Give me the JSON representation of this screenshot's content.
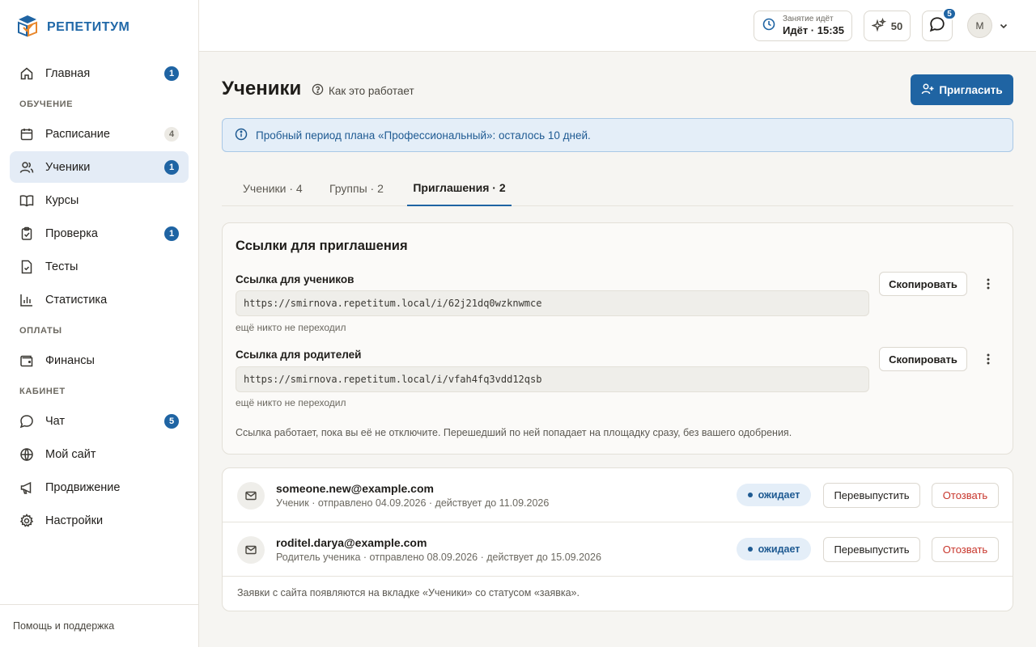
{
  "brand": {
    "name": "РЕПЕТИТУМ"
  },
  "sidebar": {
    "items": [
      {
        "label": "Главная",
        "badge": "1",
        "icon": "home-icon"
      },
      {
        "section": "ОБУЧЕНИЕ"
      },
      {
        "label": "Расписание",
        "badge": "4",
        "icon": "calendar-icon"
      },
      {
        "label": "Ученики",
        "badge": "1",
        "icon": "users-icon",
        "active": true
      },
      {
        "label": "Курсы",
        "icon": "book-icon"
      },
      {
        "label": "Проверка",
        "badge": "1",
        "icon": "clipboard-check-icon"
      },
      {
        "label": "Тесты",
        "icon": "test-file-icon"
      },
      {
        "label": "Статистика",
        "icon": "bar-chart-icon"
      },
      {
        "section": "ОПЛАТЫ"
      },
      {
        "label": "Финансы",
        "icon": "wallet-icon"
      },
      {
        "section": "КАБИНЕТ"
      },
      {
        "label": "Чат",
        "badge": "5",
        "icon": "chat-icon"
      },
      {
        "label": "Мой сайт",
        "icon": "globe-icon"
      },
      {
        "label": "Продвижение",
        "icon": "megaphone-icon"
      },
      {
        "label": "Настройки",
        "icon": "gear-icon"
      }
    ],
    "footer": "Помощь и поддержка"
  },
  "topbar": {
    "lesson_caption": "Занятие идёт",
    "lesson_status": "Идёт · 15:35",
    "points": "50",
    "chat_badge": "5",
    "avatar_initial": "М"
  },
  "page": {
    "title": "Ученики",
    "howto": "Как это работает",
    "invite_button": "Пригласить",
    "trial_notice": "Пробный период плана «Профессиональный»: осталось 10 дней."
  },
  "tabs": [
    {
      "label": "Ученики · 4"
    },
    {
      "label": "Группы · 2"
    },
    {
      "label": "Приглашения · 2",
      "active": true
    }
  ],
  "links": {
    "title": "Ссылки для приглашения",
    "items": [
      {
        "label": "Ссылка для учеников",
        "url": "https://smirnova.repetitum.local/i/62j21dq0wzknwmce",
        "note": "ещё никто не переходил",
        "copy": "Скопировать"
      },
      {
        "label": "Ссылка для родителей",
        "url": "https://smirnova.repetitum.local/i/vfah4fq3vdd12qsb",
        "note": "ещё никто не переходил",
        "copy": "Скопировать"
      }
    ],
    "footer": "Ссылка работает, пока вы её не отключите. Перешедший по ней попадает на площадку сразу, без вашего одобрения."
  },
  "invitations": {
    "rows": [
      {
        "email": "someone.new@example.com",
        "meta": "Ученик · отправлено 04.09.2026 · действует до 11.09.2026",
        "status": "ожидает",
        "reissue": "Перевыпустить",
        "revoke": "Отозвать"
      },
      {
        "email": "roditel.darya@example.com",
        "meta": "Родитель ученика · отправлено 08.09.2026 · действует до 15.09.2026",
        "status": "ожидает",
        "reissue": "Перевыпустить",
        "revoke": "Отозвать"
      }
    ],
    "footer": "Заявки с сайта появляются на вкладке «Ученики» со статусом «заявка»."
  },
  "colors": {
    "accent": "#1f64a3",
    "danger": "#c8352b",
    "info_bg": "#e4eef8"
  }
}
